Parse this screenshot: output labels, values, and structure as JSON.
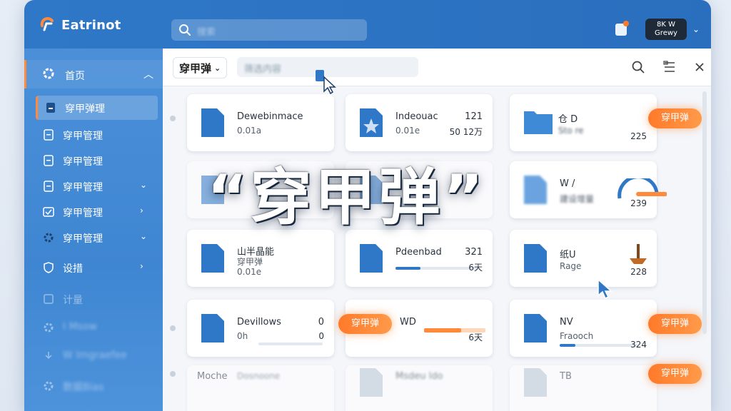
{
  "app": {
    "name": "Eatrinot"
  },
  "header": {
    "search_placeholder": "搜索",
    "account": {
      "line1": "8K W",
      "line2": "Grewy"
    }
  },
  "sidebar": {
    "home": {
      "label": "首页",
      "icon": "home-icon"
    },
    "items": [
      {
        "label": "穿甲弹理",
        "icon": "document-icon",
        "active": true
      },
      {
        "label": "穿甲管理",
        "icon": "document-icon"
      },
      {
        "label": "穿甲管理",
        "icon": "document-icon"
      },
      {
        "label": "穿甲管理",
        "icon": "document-icon",
        "chevron": "⌄"
      },
      {
        "label": "穿甲管理",
        "icon": "checkbox-icon",
        "chevron": "›"
      },
      {
        "label": "穿甲管理",
        "icon": "gear-icon",
        "chevron": "⌄"
      },
      {
        "label": "设措",
        "icon": "shield-icon",
        "chevron": "›"
      },
      {
        "label": "计量",
        "icon": "calc-icon"
      },
      {
        "label": "I Msow",
        "icon": "gear-icon"
      },
      {
        "label": "W lmgraefee",
        "icon": "download-icon"
      },
      {
        "label": "数据Bias",
        "icon": "gear-icon"
      }
    ]
  },
  "toolbar": {
    "dropdown_label": "穿甲弹",
    "filter_text": "筛选内容",
    "icons": [
      "search-icon",
      "list-icon",
      "close-icon"
    ]
  },
  "headline": "“穿甲弹”",
  "cards": [
    {
      "name": "Dewebinmace",
      "sub": "0.01a",
      "num": "",
      "num2": "",
      "pill": "",
      "progress": null
    },
    {
      "name": "Indeouac",
      "sub": "0.01e",
      "num": "121",
      "num2": "50 12万",
      "pill": "",
      "progress": null
    },
    {
      "name": "仓 D",
      "sub": "Sto re",
      "num": "",
      "num2": "225",
      "pill": "穿甲弹",
      "progress": null
    },
    {
      "name": "",
      "sub": "",
      "num": "",
      "num2": "",
      "pill": "",
      "progress": null
    },
    {
      "name": "",
      "sub": "",
      "num": "",
      "num2": "",
      "pill": "",
      "progress": null
    },
    {
      "name": "W /",
      "sub": "建设增量",
      "num": "",
      "num2": "239",
      "pill": "",
      "progress": 0.8
    },
    {
      "name": "山半晶能",
      "sub": "穿甲弹",
      "num": "",
      "num2": "0.01e",
      "pill": "",
      "progress": null
    },
    {
      "name": "Pdeenbad",
      "sub": "",
      "num": "321",
      "num2": "6天",
      "pill": "",
      "progress": 0.3
    },
    {
      "name": "纸U",
      "sub": "Rage",
      "num": "",
      "num2": "228",
      "pill": "",
      "progress": null
    },
    {
      "name": "Devillows",
      "sub": "0h",
      "num": "0",
      "num2": "0",
      "pill": "",
      "progress": 0.0
    },
    {
      "name": "WD",
      "sub": "",
      "num": "",
      "num2": "6天",
      "pill": "穿甲弹",
      "progress": 0.6
    },
    {
      "name": "NV",
      "sub": "Fraooch",
      "num": "",
      "num2": "324",
      "pill": "穿甲弹",
      "progress": 0.2
    },
    {
      "name": "Moche",
      "sub": "Dosnoone",
      "num": "",
      "num2": "",
      "pill": "",
      "progress": null
    },
    {
      "name": "Msdeu ldo",
      "sub": "",
      "num": "",
      "num2": "",
      "pill": "",
      "progress": null
    },
    {
      "name": "TB",
      "sub": "",
      "num": "",
      "num2": "",
      "pill": "穿甲弹",
      "progress": null
    }
  ],
  "colors": {
    "primary": "#2f78c8",
    "accent": "#ff8a3c",
    "sidebar": "#4a8fd8"
  }
}
